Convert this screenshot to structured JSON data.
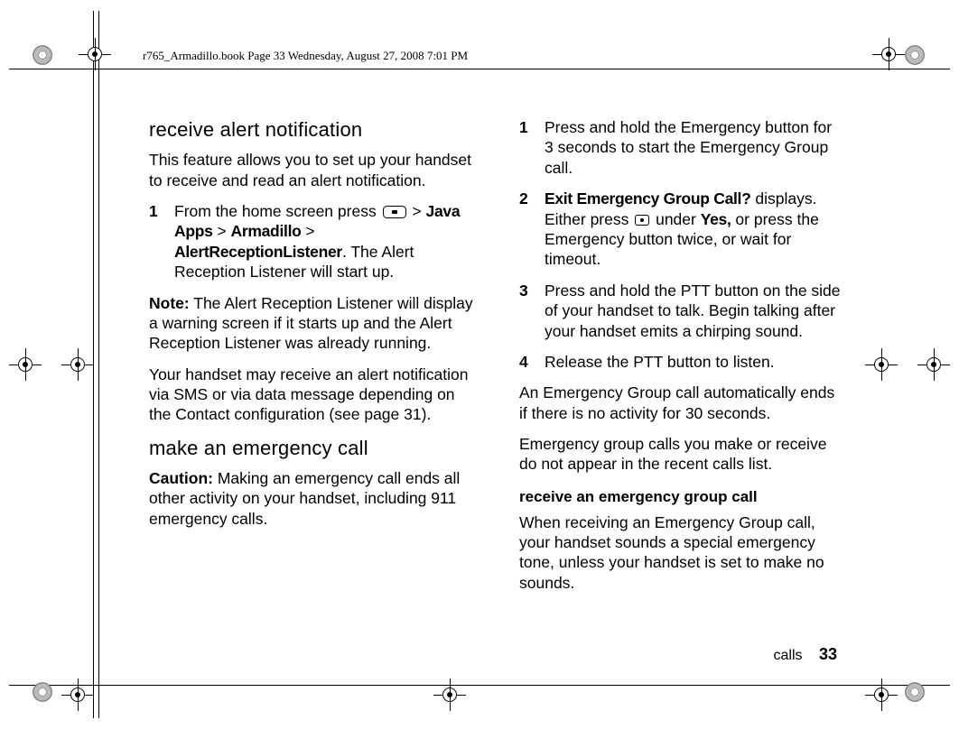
{
  "running_head": "r765_Armadillo.book  Page 33  Wednesday, August 27, 2008  7:01 PM",
  "left": {
    "h1": "receive alert notification",
    "p1": "This feature allows you to set up your handset to receive and read an alert notification.",
    "step1_pre": "From the home screen press ",
    "step1_mid1": " > ",
    "step1_b1": "Java Apps",
    "step1_mid2": " > ",
    "step1_b2": "Armadillo",
    "step1_mid3": " > ",
    "step1_b3": "AlertReceptionListener",
    "step1_post": ". The Alert Reception Listener will start up.",
    "note_label": "Note:",
    "note_body": " The Alert Reception Listener will display a warning screen if it starts up and the Alert Reception Listener was already running.",
    "p2": "Your handset may receive an alert notification via SMS or via data message depending on the Contact configuration (see page 31).",
    "h2": "make an emergency call",
    "caution_label": "Caution:",
    "caution_body": " Making an emergency call ends all other activity on your handset, including 911 emergency calls."
  },
  "right": {
    "step1": "Press and hold the Emergency button for 3 seconds to start the Emergency Group call.",
    "step2_b1": "Exit Emergency Group Call?",
    "step2_t1": " displays. Either press ",
    "step2_t2": " under ",
    "step2_b2": "Yes,",
    "step2_t3": " or press the Emergency button twice, or wait for timeout.",
    "step3": "Press and hold the PTT button on the side of your handset to talk. Begin talking after your handset emits a chirping sound.",
    "step4": "Release the PTT button to listen.",
    "p1": "An Emergency Group call automatically ends if there is no activity for 30 seconds.",
    "p2": "Emergency group calls you make or receive do not appear in the recent calls list.",
    "h_sub": "receive an emergency group call",
    "p3": "When receiving an Emergency Group call, your handset sounds a special emergency tone, unless your handset is set to make no sounds."
  },
  "footer": {
    "section": "calls",
    "page": "33"
  },
  "nums": {
    "n1": "1",
    "n2": "2",
    "n3": "3",
    "n4": "4"
  }
}
